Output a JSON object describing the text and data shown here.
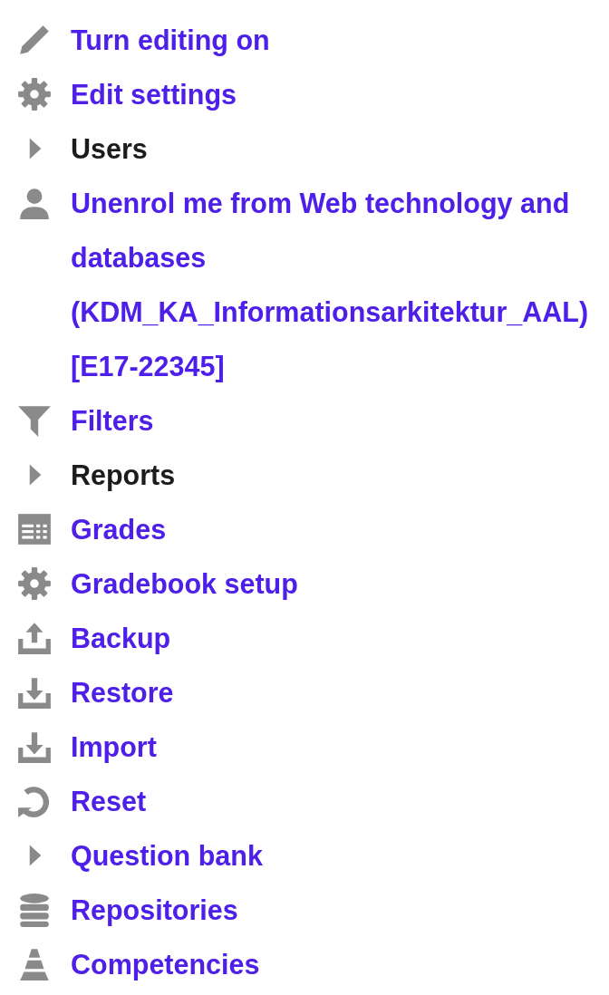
{
  "menu": {
    "items": [
      {
        "kind": "pencil",
        "label": "Turn editing on",
        "link": true
      },
      {
        "kind": "gear",
        "label": "Edit settings",
        "link": true
      },
      {
        "kind": "caret",
        "label": "Users",
        "link": false
      },
      {
        "kind": "person",
        "label": "Unenrol me from Web technology and databases (KDM_KA_Informationsarkitektur_AAL) [E17-22345]",
        "link": true
      },
      {
        "kind": "filter",
        "label": "Filters",
        "link": true
      },
      {
        "kind": "caret",
        "label": "Reports",
        "link": false
      },
      {
        "kind": "table",
        "label": "Grades",
        "link": true
      },
      {
        "kind": "gear",
        "label": "Gradebook setup",
        "link": true
      },
      {
        "kind": "upload",
        "label": "Backup",
        "link": true
      },
      {
        "kind": "download",
        "label": "Restore",
        "link": true
      },
      {
        "kind": "download",
        "label": "Import",
        "link": true
      },
      {
        "kind": "reset",
        "label": "Reset",
        "link": true
      },
      {
        "kind": "caret",
        "label": "Question bank",
        "link": true
      },
      {
        "kind": "database",
        "label": "Repositories",
        "link": true
      },
      {
        "kind": "pyramid",
        "label": "Competencies",
        "link": true
      }
    ]
  }
}
